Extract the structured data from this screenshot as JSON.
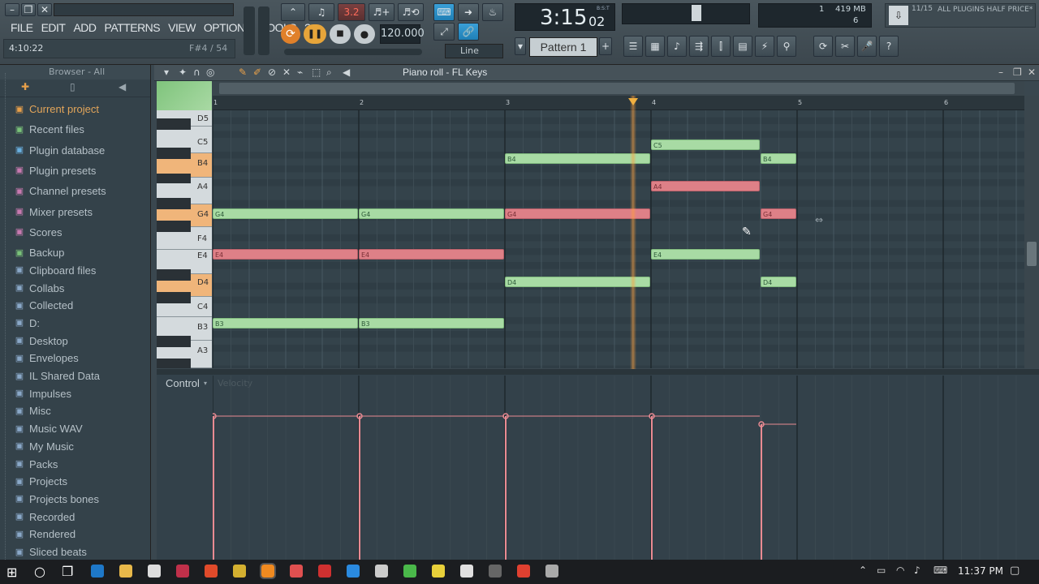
{
  "menu": [
    "FILE",
    "EDIT",
    "ADD",
    "PATTERNS",
    "VIEW",
    "OPTIONS",
    "TOOLS",
    "?"
  ],
  "hint": {
    "left": "4:10:22",
    "right": "F#4 / 54"
  },
  "transport": {
    "tempo": "120.000",
    "time_main": "3:15",
    "time_sub": "02",
    "time_unit": "B:S:T",
    "snap": "Line",
    "pattern": "Pattern 1"
  },
  "stats": {
    "cpu_num": "1",
    "memory": "419 MB",
    "polyphony": "6"
  },
  "news": {
    "count": "11/15",
    "text": "ALL PLUGINS HALF PRICE*"
  },
  "browser": {
    "title": "Browser - All",
    "items": [
      "Current project",
      "Recent files",
      "Plugin database",
      "Plugin presets",
      "Channel presets",
      "Mixer presets",
      "Scores",
      "Backup",
      "Clipboard files",
      "Collabs",
      "Collected",
      "D:",
      "Desktop",
      "Envelopes",
      "IL Shared Data",
      "Impulses",
      "Misc",
      "Music WAV",
      "My Music",
      "Packs",
      "Projects",
      "Projects bones",
      "Recorded",
      "Rendered",
      "Sliced beats"
    ]
  },
  "pianoroll": {
    "title": "Piano roll - FL Keys",
    "bars": [
      "1",
      "2",
      "3",
      "4",
      "5",
      "6"
    ],
    "keys": [
      "D5",
      "C5",
      "B4",
      "A4",
      "G4",
      "F4",
      "E4",
      "D4",
      "C4",
      "B3",
      "A3"
    ],
    "control_label": "Control",
    "control_sub": "Velocity",
    "notes": [
      {
        "label": "G4",
        "start": 1,
        "len": 1,
        "pitch": "G4",
        "color": "g"
      },
      {
        "label": "G4",
        "start": 2,
        "len": 1,
        "pitch": "G4",
        "color": "g"
      },
      {
        "label": "E4",
        "start": 1,
        "len": 1,
        "pitch": "E4",
        "color": "r"
      },
      {
        "label": "E4",
        "start": 2,
        "len": 1,
        "pitch": "E4",
        "color": "r"
      },
      {
        "label": "B3",
        "start": 1,
        "len": 1,
        "pitch": "B3",
        "color": "g"
      },
      {
        "label": "B3",
        "start": 2,
        "len": 1,
        "pitch": "B3",
        "color": "g"
      },
      {
        "label": "B4",
        "start": 3,
        "len": 1,
        "pitch": "B4",
        "color": "g"
      },
      {
        "label": "G4",
        "start": 3,
        "len": 1,
        "pitch": "G4",
        "color": "r"
      },
      {
        "label": "D4",
        "start": 3,
        "len": 1,
        "pitch": "D4",
        "color": "g"
      },
      {
        "label": "C5",
        "start": 4,
        "len": 0.75,
        "pitch": "C5",
        "color": "g"
      },
      {
        "label": "A4",
        "start": 4,
        "len": 0.75,
        "pitch": "A4",
        "color": "r"
      },
      {
        "label": "E4",
        "start": 4,
        "len": 0.75,
        "pitch": "E4",
        "color": "g"
      },
      {
        "label": "B4",
        "start": 4.75,
        "len": 0.25,
        "pitch": "B4",
        "color": "g"
      },
      {
        "label": "G4",
        "start": 4.75,
        "len": 0.25,
        "pitch": "G4",
        "color": "r"
      },
      {
        "label": "D4",
        "start": 4.75,
        "len": 0.25,
        "pitch": "D4",
        "color": "g"
      }
    ]
  },
  "taskbar": {
    "time": "11:37 PM"
  }
}
